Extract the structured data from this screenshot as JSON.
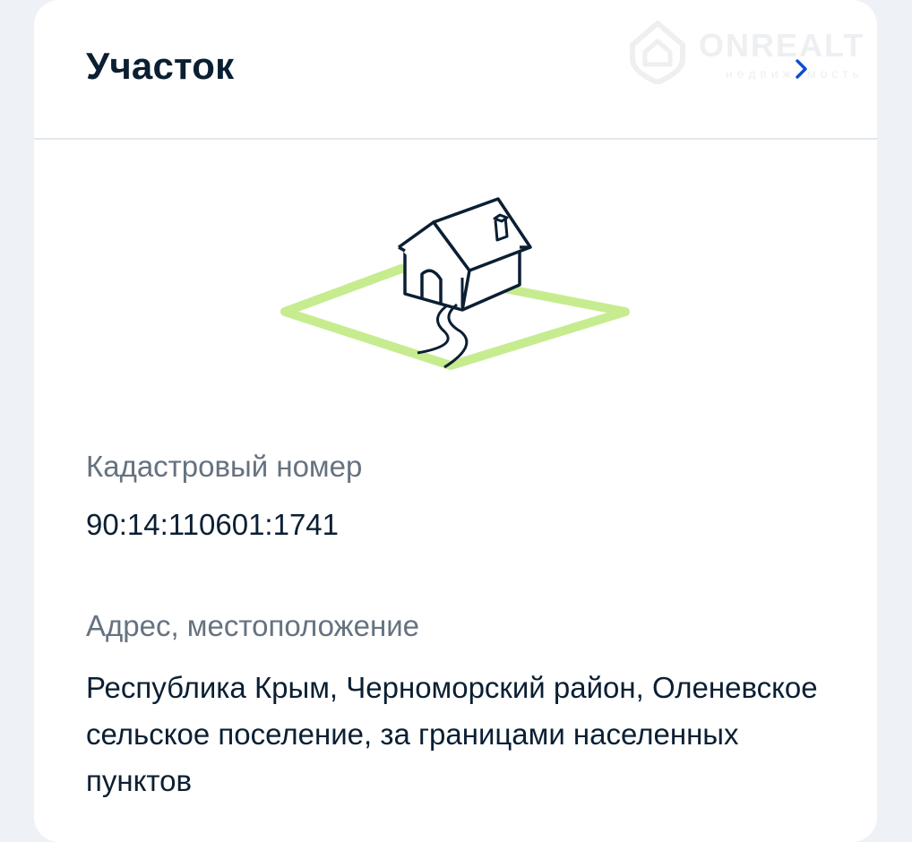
{
  "card": {
    "title": "Участок"
  },
  "watermark": {
    "logo_text": "ONREALT",
    "sub_text": "недвижимость"
  },
  "fields": [
    {
      "label": "Кадастровый номер",
      "value": "90:14:110601:1741"
    },
    {
      "label": "Адрес, местоположение",
      "value": "Республика Крым, Черноморский район, Оленевское сельское поселение, за границами населенных пунктов"
    }
  ],
  "icons": {
    "chevron": "chevron-right-icon",
    "illustration": "house-plot-icon",
    "watermark": "house-logo-icon"
  },
  "colors": {
    "title": "#0b1f33",
    "label": "#66727f",
    "chevron": "#0d4cd3",
    "plot_outline": "#c6ec8f"
  }
}
